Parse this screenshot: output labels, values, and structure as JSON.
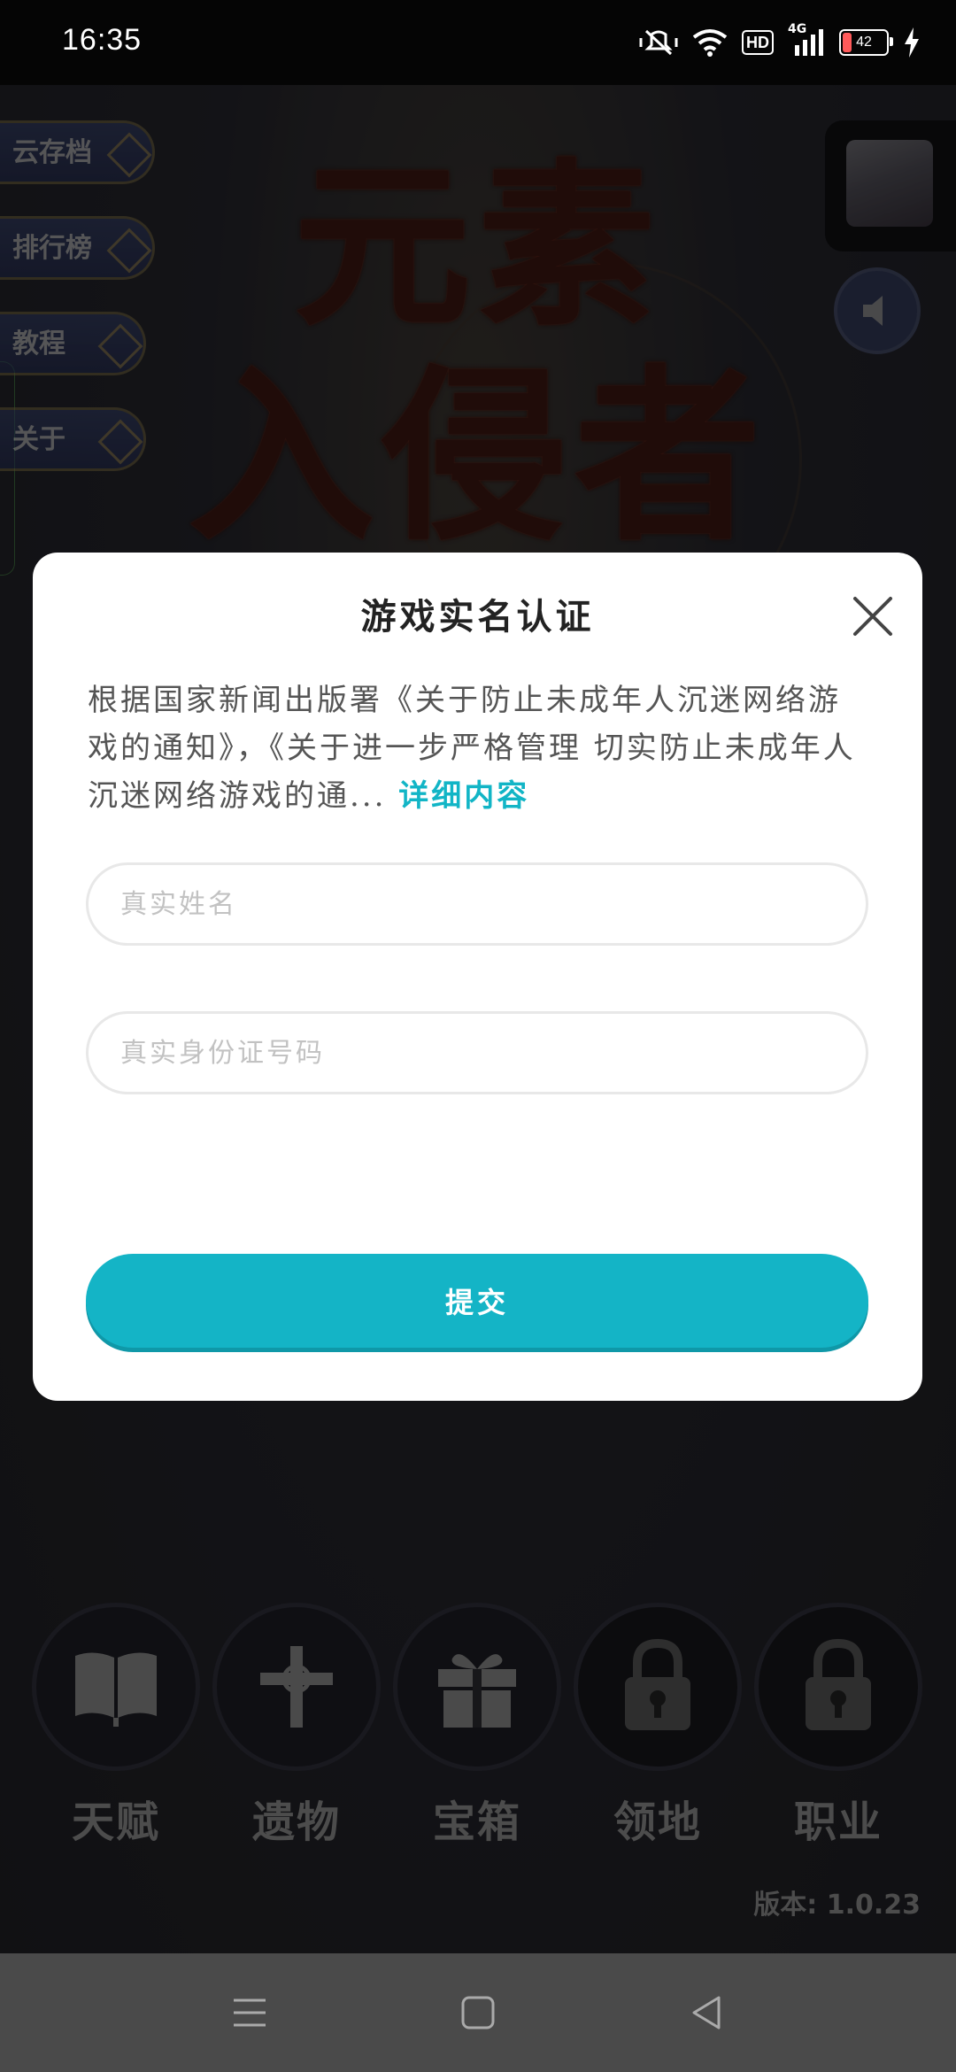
{
  "status_bar": {
    "time": "16:35",
    "hd_label": "HD",
    "network_label": "4G",
    "battery_level": "42",
    "icons": [
      "mute-vibrate-icon",
      "wifi-icon",
      "hd-icon",
      "signal-icon",
      "battery-icon",
      "charging-icon"
    ]
  },
  "game": {
    "title_line1": "元素",
    "title_line2": "入侵者",
    "side_menu": [
      {
        "label": "云存档"
      },
      {
        "label": "排行榜"
      },
      {
        "label": "教程"
      },
      {
        "label": "关于"
      }
    ],
    "features": [
      {
        "label": "天赋",
        "icon": "book-icon"
      },
      {
        "label": "遗物",
        "icon": "cross-icon"
      },
      {
        "label": "宝箱",
        "icon": "gift-icon"
      },
      {
        "label": "领地",
        "icon": "lock-icon"
      },
      {
        "label": "职业",
        "icon": "lock-icon"
      }
    ],
    "version": "版本: 1.0.23"
  },
  "dialog": {
    "title": "游戏实名认证",
    "body_text": "根据国家新闻出版署《关于防止未成年人沉迷网络游戏的通知》，《关于进一步严格管理 切实防止未成年人沉迷网络游戏的通...",
    "detail_link": "详细内容",
    "name_placeholder": "真实姓名",
    "id_placeholder": "真实身份证号码",
    "submit_label": "提交",
    "accent_color": "#14b4c6"
  },
  "nav_bar": {
    "buttons": [
      "menu-icon",
      "home-icon",
      "back-icon"
    ]
  }
}
